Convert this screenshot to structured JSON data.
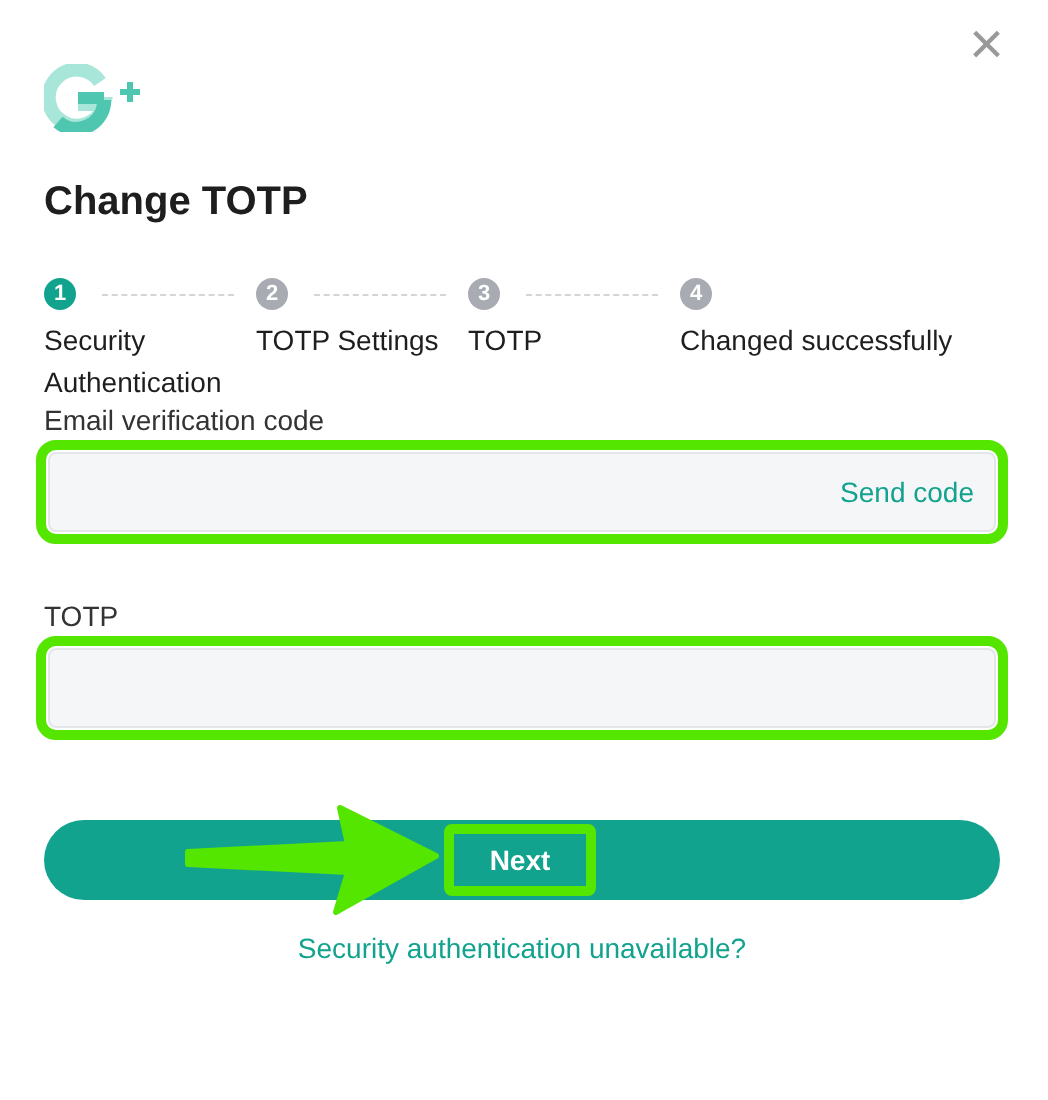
{
  "dialog": {
    "title": "Change TOTP",
    "close": "×"
  },
  "steps": [
    {
      "number": "1",
      "label": "Security Authentication",
      "selected": true
    },
    {
      "number": "2",
      "label": "TOTP Settings",
      "selected": false
    },
    {
      "number": "3",
      "label": "TOTP",
      "selected": false
    },
    {
      "number": "4",
      "label": "Changed successfully",
      "selected": false
    }
  ],
  "fields": [
    {
      "label": "Email verification code",
      "action": "Send code",
      "highlighted": true
    },
    {
      "label": "TOTP",
      "highlighted": true
    }
  ],
  "next_button": {
    "label": "Next",
    "highlighted": true
  },
  "link": "Security authentication unavailable?"
}
